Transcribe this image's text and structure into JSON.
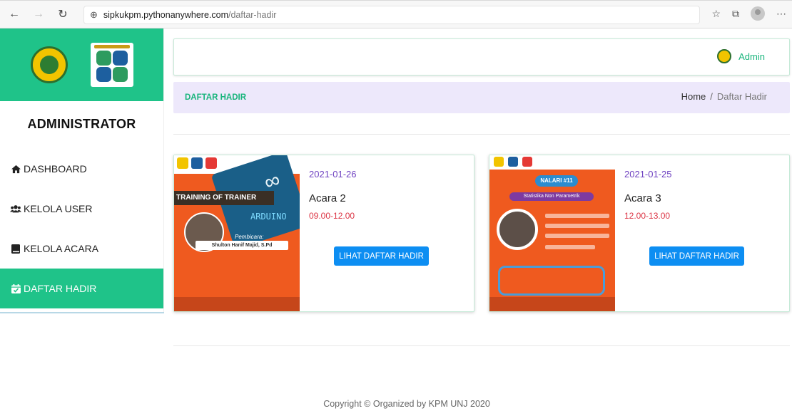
{
  "browser": {
    "url_domain": "sipkukpm.pythonanywhere.com",
    "url_path": "/daftar-hadir"
  },
  "sidebar": {
    "title": "ADMINISTRATOR",
    "items": [
      {
        "label": "DASHBOARD",
        "icon": "home-icon",
        "active": false
      },
      {
        "label": "KELOLA USER",
        "icon": "users-icon",
        "active": false
      },
      {
        "label": "KELOLA ACARA",
        "icon": "book-icon",
        "active": false
      },
      {
        "label": "DAFTAR HADIR",
        "icon": "calendar-check-icon",
        "active": true
      }
    ]
  },
  "topbar": {
    "user_name": "Admin"
  },
  "page_header": {
    "title": "DAFTAR HADIR",
    "breadcrumb": [
      {
        "label": "Home"
      },
      {
        "label": "Daftar Hadir"
      }
    ],
    "breadcrumb_separator": "/"
  },
  "events": [
    {
      "date": "2021-01-26",
      "name": "Acara 2",
      "time": "09.00-12.00",
      "button_label": "LIHAT DAFTAR HADIR",
      "poster": {
        "heading": "TRAINING OF TRAINER",
        "subject": "ARDUINO",
        "speaker_caption": "Pembicara:",
        "speaker_name": "Shulton Hanif Majid, S.Pd"
      }
    },
    {
      "date": "2021-01-25",
      "name": "Acara 3",
      "time": "12.00-13.00",
      "button_label": "LIHAT DAFTAR HADIR",
      "poster": {
        "heading": "NALARI #11",
        "subject": "Statistika Non Parametrik"
      }
    }
  ],
  "footer": {
    "text": "Copyright © Organized by KPM UNJ 2020"
  },
  "colors": {
    "brand_green": "#1fc389",
    "accent_green_text": "#19b57c",
    "header_bg": "#ede8fb",
    "date_purple": "#6f42c1",
    "time_red": "#dc3545",
    "button_blue": "#0d8ef2",
    "poster_orange": "#ef5a1f"
  }
}
